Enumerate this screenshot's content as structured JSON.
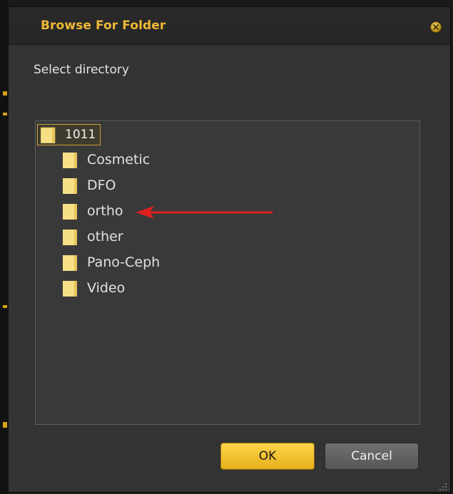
{
  "dialog": {
    "title": "Browse For Folder",
    "prompt": "Select directory"
  },
  "tree": {
    "root": {
      "label": "1011",
      "selected": true
    },
    "children": [
      {
        "label": "Cosmetic"
      },
      {
        "label": "DFO"
      },
      {
        "label": "ortho",
        "highlighted_by_arrow": true
      },
      {
        "label": "other"
      },
      {
        "label": "Pano-Ceph"
      },
      {
        "label": "Video"
      }
    ]
  },
  "buttons": {
    "ok_label": "OK",
    "cancel_label": "Cancel"
  },
  "icons": {
    "close": "close-icon",
    "folder": "folder-icon",
    "annotation": "red-arrow-icon",
    "resize": "resize-grip-icon"
  },
  "colors": {
    "title": "#f0b836",
    "accent": "#ffd34a",
    "folder": "#f5d97a",
    "annotation_arrow": "#e02020",
    "window_bg": "#333334"
  }
}
